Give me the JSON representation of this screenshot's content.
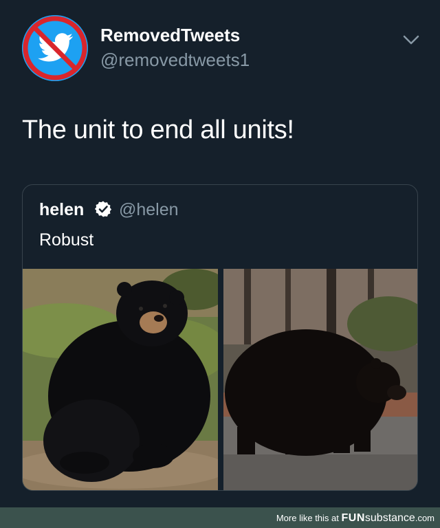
{
  "tweet": {
    "display_name": "RemovedTweets",
    "handle": "@removedtweets1",
    "text": "The unit to end all units!",
    "avatar_icon": "no-twitter-bird-icon",
    "accent_color": "#1da1f2"
  },
  "quoted_tweet": {
    "display_name": "helen",
    "verified_icon": "verified-badge-icon",
    "handle": "@helen",
    "text": "Robust",
    "photos": [
      "sitting-black-bear-photo",
      "walking-black-bear-photo"
    ]
  },
  "footer": {
    "prefix": "More like this at ",
    "brand_fun": "FUN",
    "brand_substance": "substance",
    "brand_tld": ".com",
    "background": "#3b524d"
  },
  "theme": {
    "background": "#15202b",
    "border": "#38444d",
    "muted_text": "#8899a6"
  }
}
